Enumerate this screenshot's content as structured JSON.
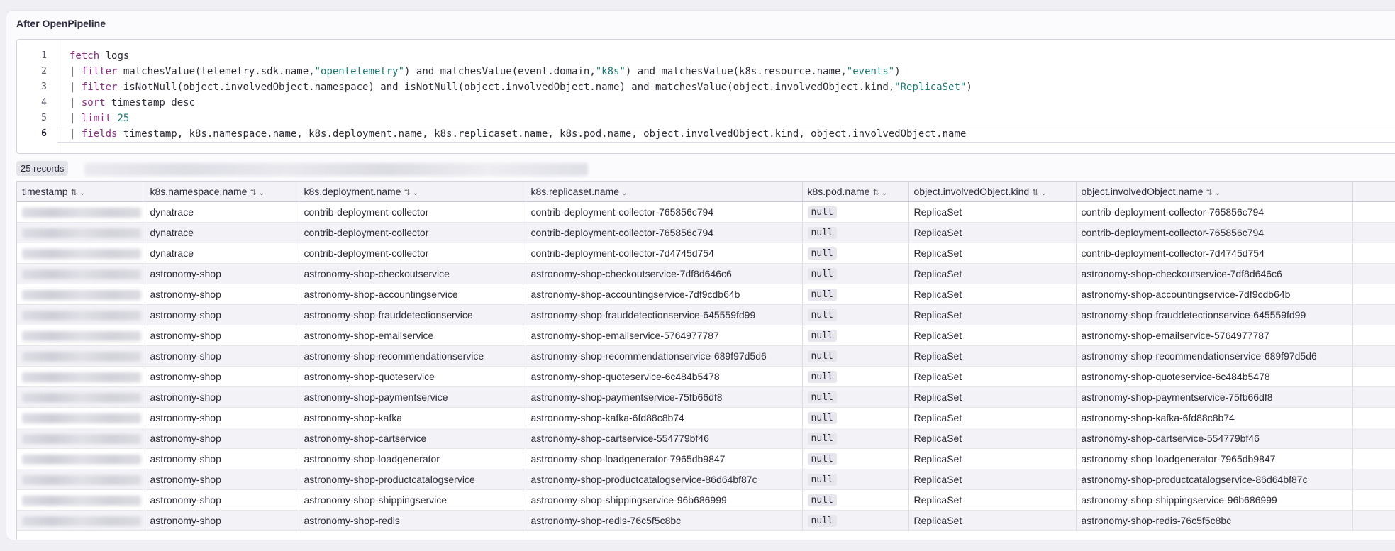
{
  "panel": {
    "title": "After OpenPipeline"
  },
  "editor": {
    "line_numbers": [
      "1",
      "2",
      "3",
      "4",
      "5",
      "6"
    ],
    "active_line": "6"
  },
  "query": {
    "l1": {
      "kw": "fetch",
      "rest": " logs"
    },
    "l2": {
      "pipe": "| ",
      "kw": "filter",
      "a": " matchesValue(telemetry.sdk.name,",
      "s1": "\"opentelemetry\"",
      "b": ") and matchesValue(event.domain,",
      "s2": "\"k8s\"",
      "c": ") and matchesValue(k8s.resource.name,",
      "s3": "\"events\"",
      "d": ")"
    },
    "l3": {
      "pipe": "| ",
      "kw": "filter",
      "a": " isNotNull(object.involvedObject.namespace) and isNotNull(object.involvedObject.name) and matchesValue(object.involvedObject.kind,",
      "s1": "\"ReplicaSet\"",
      "b": ")"
    },
    "l4": {
      "pipe": "| ",
      "kw": "sort",
      "rest": " timestamp desc"
    },
    "l5": {
      "pipe": "| ",
      "kw": "limit",
      "num": " 25"
    },
    "l6": {
      "pipe": "| ",
      "kw": "fields",
      "rest": " timestamp, k8s.namespace.name, k8s.deployment.name, k8s.replicaset.name, k8s.pod.name, object.involvedObject.kind, object.involvedObject.name"
    }
  },
  "records_label": "25 records",
  "table": {
    "headers": [
      "timestamp",
      "k8s.namespace.name",
      "k8s.deployment.name",
      "k8s.replicaset.name",
      "k8s.pod.name",
      "object.involvedObject.kind",
      "object.involvedObject.name"
    ],
    "sort_icon": "⇅",
    "chevron_icon": "⌄",
    "null_label": "null",
    "rows": [
      [
        "dynatrace",
        "contrib-deployment-collector",
        "contrib-deployment-collector-765856c794",
        "ReplicaSet",
        "contrib-deployment-collector-765856c794"
      ],
      [
        "dynatrace",
        "contrib-deployment-collector",
        "contrib-deployment-collector-765856c794",
        "ReplicaSet",
        "contrib-deployment-collector-765856c794"
      ],
      [
        "dynatrace",
        "contrib-deployment-collector",
        "contrib-deployment-collector-7d4745d754",
        "ReplicaSet",
        "contrib-deployment-collector-7d4745d754"
      ],
      [
        "astronomy-shop",
        "astronomy-shop-checkoutservice",
        "astronomy-shop-checkoutservice-7df8d646c6",
        "ReplicaSet",
        "astronomy-shop-checkoutservice-7df8d646c6"
      ],
      [
        "astronomy-shop",
        "astronomy-shop-accountingservice",
        "astronomy-shop-accountingservice-7df9cdb64b",
        "ReplicaSet",
        "astronomy-shop-accountingservice-7df9cdb64b"
      ],
      [
        "astronomy-shop",
        "astronomy-shop-frauddetectionservice",
        "astronomy-shop-frauddetectionservice-645559fd99",
        "ReplicaSet",
        "astronomy-shop-frauddetectionservice-645559fd99"
      ],
      [
        "astronomy-shop",
        "astronomy-shop-emailservice",
        "astronomy-shop-emailservice-5764977787",
        "ReplicaSet",
        "astronomy-shop-emailservice-5764977787"
      ],
      [
        "astronomy-shop",
        "astronomy-shop-recommendationservice",
        "astronomy-shop-recommendationservice-689f97d5d6",
        "ReplicaSet",
        "astronomy-shop-recommendationservice-689f97d5d6"
      ],
      [
        "astronomy-shop",
        "astronomy-shop-quoteservice",
        "astronomy-shop-quoteservice-6c484b5478",
        "ReplicaSet",
        "astronomy-shop-quoteservice-6c484b5478"
      ],
      [
        "astronomy-shop",
        "astronomy-shop-paymentservice",
        "astronomy-shop-paymentservice-75fb66df8",
        "ReplicaSet",
        "astronomy-shop-paymentservice-75fb66df8"
      ],
      [
        "astronomy-shop",
        "astronomy-shop-kafka",
        "astronomy-shop-kafka-6fd88c8b74",
        "ReplicaSet",
        "astronomy-shop-kafka-6fd88c8b74"
      ],
      [
        "astronomy-shop",
        "astronomy-shop-cartservice",
        "astronomy-shop-cartservice-554779bf46",
        "ReplicaSet",
        "astronomy-shop-cartservice-554779bf46"
      ],
      [
        "astronomy-shop",
        "astronomy-shop-loadgenerator",
        "astronomy-shop-loadgenerator-7965db9847",
        "ReplicaSet",
        "astronomy-shop-loadgenerator-7965db9847"
      ],
      [
        "astronomy-shop",
        "astronomy-shop-productcatalogservice",
        "astronomy-shop-productcatalogservice-86d64bf87c",
        "ReplicaSet",
        "astronomy-shop-productcatalogservice-86d64bf87c"
      ],
      [
        "astronomy-shop",
        "astronomy-shop-shippingservice",
        "astronomy-shop-shippingservice-96b686999",
        "ReplicaSet",
        "astronomy-shop-shippingservice-96b686999"
      ],
      [
        "astronomy-shop",
        "astronomy-shop-redis",
        "astronomy-shop-redis-76c5f5c8bc",
        "ReplicaSet",
        "astronomy-shop-redis-76c5f5c8bc"
      ]
    ]
  }
}
